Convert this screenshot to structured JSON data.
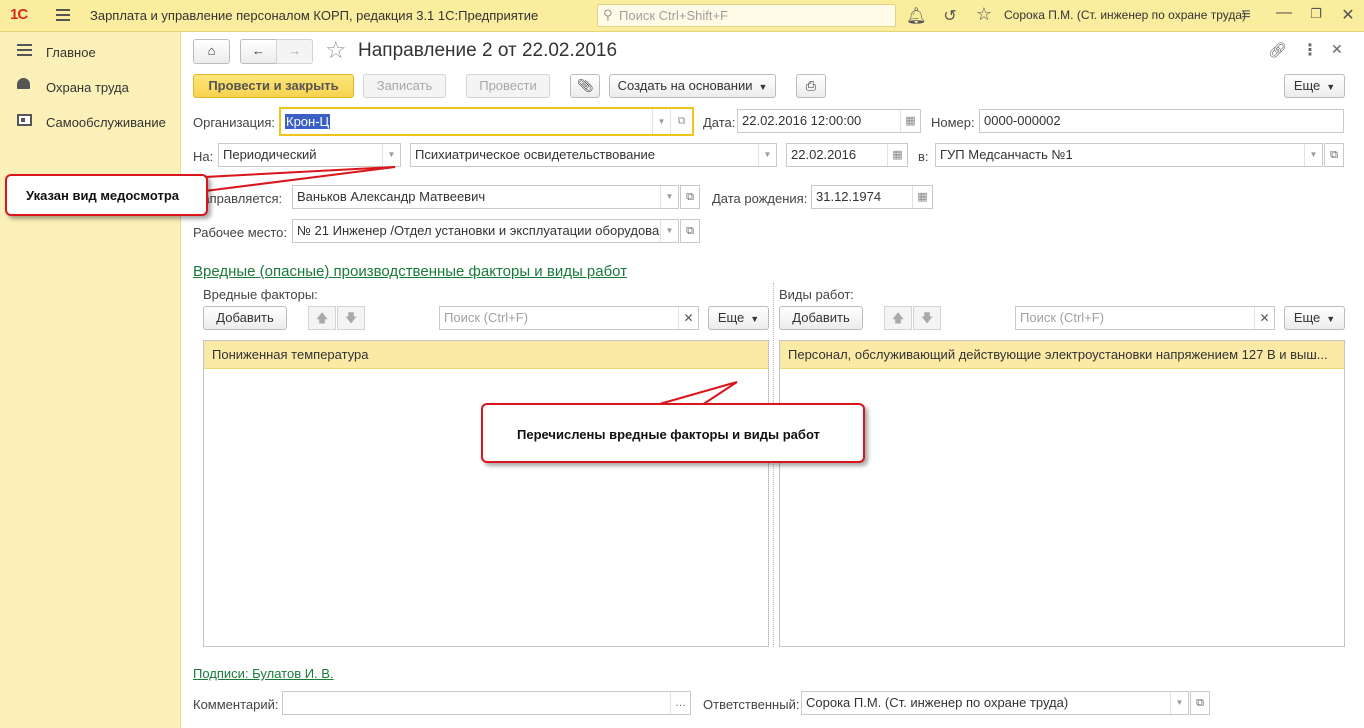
{
  "topbar": {
    "logo": "1С",
    "app_title": "Зарплата и управление персоналом КОРП, редакция 3.1 1С:Предприятие",
    "search_placeholder": "Поиск Ctrl+Shift+F",
    "user": "Сорока П.М. (Ст. инженер по охране труда)"
  },
  "sidebar": {
    "items": [
      {
        "label": "Главное",
        "icon": "menu-lines-icon"
      },
      {
        "label": "Охрана труда",
        "icon": "helmet-icon"
      },
      {
        "label": "Самообслуживание",
        "icon": "id-card-icon"
      }
    ]
  },
  "form": {
    "title": "Направление 2 от 22.02.2016",
    "toolbar": {
      "post_close": "Провести и закрыть",
      "write": "Записать",
      "post": "Провести",
      "create_based": "Создать на основании",
      "more": "Еще"
    },
    "org_label": "Организация:",
    "org_value": "Крон-Ц",
    "date_label": "Дата:",
    "date_value": "22.02.2016 12:00:00",
    "number_label": "Номер:",
    "number_value": "0000-000002",
    "na_label": "На:",
    "exam_type": "Периодический",
    "exam_kind": "Психиатрическое освидетельствование",
    "exam_date": "22.02.2016",
    "in_label": "в:",
    "clinic": "ГУП Медсанчасть №1",
    "sent_label": "Направляется:",
    "employee": "Ваньков Александр Матвеевич",
    "birth_label": "Дата рождения:",
    "birth_value": "31.12.1974",
    "workplace_label": "Рабочее место:",
    "workplace_value": "№ 21 Инженер /Отдел установки и эксплуатации оборудова",
    "section_link": "Вредные (опасные) производственные факторы и виды работ",
    "factors": {
      "title": "Вредные факторы:",
      "add": "Добавить",
      "search_placeholder": "Поиск (Ctrl+F)",
      "more": "Еще",
      "rows": [
        "Пониженная температура"
      ]
    },
    "works": {
      "title": "Виды работ:",
      "add": "Добавить",
      "search_placeholder": "Поиск (Ctrl+F)",
      "more": "Еще",
      "rows": [
        "Персонал, обслуживающий действующие электроустановки напряжением 127 В и выш..."
      ]
    },
    "signatures_link": "Подписи: Булатов И. В.",
    "comment_label": "Комментарий:",
    "comment_value": "",
    "responsible_label": "Ответственный:",
    "responsible_value": "Сорока П.М. (Ст. инженер по охране труда)"
  },
  "callouts": {
    "exam_kind": "Указан вид медосмотра",
    "factors": "Перечислены вредные факторы и виды работ"
  },
  "colors": {
    "topbar": "#fbed9e",
    "sidebar": "#fbf1b8",
    "accent_button": "#f7d24f",
    "selected_row": "#fbe9a6",
    "link": "#1a7a3a",
    "callout_border": "#d8161b"
  }
}
